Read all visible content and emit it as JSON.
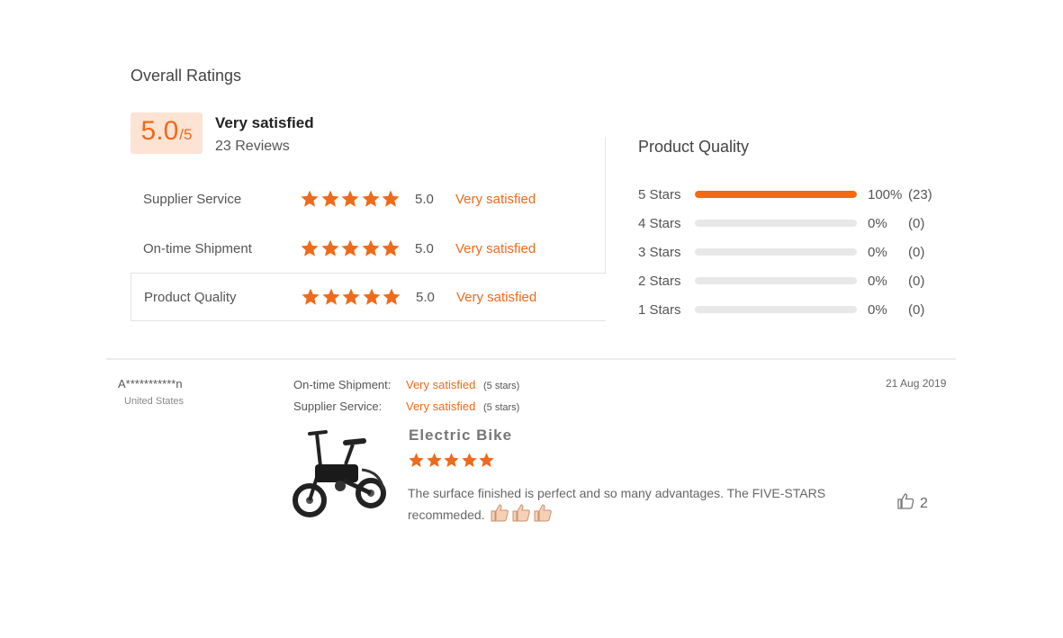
{
  "overall": {
    "title": "Overall Ratings",
    "score": "5.0",
    "out_of": "/5",
    "summary": "Very satisfied",
    "reviews": "23 Reviews"
  },
  "ratings": [
    {
      "label": "Supplier Service",
      "stars": 5,
      "score": "5.0",
      "text": "Very satisfied"
    },
    {
      "label": "On-time Shipment",
      "stars": 5,
      "score": "5.0",
      "text": "Very satisfied"
    },
    {
      "label": "Product Quality",
      "stars": 5,
      "score": "5.0",
      "text": "Very satisfied"
    }
  ],
  "product_quality": {
    "title": "Product Quality",
    "rows": [
      {
        "label": "5 Stars",
        "percent": "100%",
        "count": "(23)",
        "fraction": 1.0
      },
      {
        "label": "4 Stars",
        "percent": "0%",
        "count": "(0)",
        "fraction": 0
      },
      {
        "label": "3 Stars",
        "percent": "0%",
        "count": "(0)",
        "fraction": 0
      },
      {
        "label": "2 Stars",
        "percent": "0%",
        "count": "(0)",
        "fraction": 0
      },
      {
        "label": "1 Stars",
        "percent": "0%",
        "count": "(0)",
        "fraction": 0
      }
    ]
  },
  "review": {
    "name": "A***********n",
    "country": "United States",
    "date": "21 Aug 2019",
    "meta": [
      {
        "label": "On-time Shipment:",
        "value": "Very satisfied",
        "stars": "(5 stars)"
      },
      {
        "label": "Supplier Service:",
        "value": "Very satisfied",
        "stars": "(5 stars)"
      }
    ],
    "product": "Electric Bike",
    "rating": 5,
    "text": "The surface finished is perfect and so many advantages. The FIVE-STARS recommeded.",
    "likes": "2"
  },
  "colors": {
    "accent": "#ef6a1a",
    "score_bg": "#fde3d4",
    "bar_fill": "#f26a14",
    "bar_track": "#e8e8e8"
  },
  "icons": [
    "star-icon",
    "thumbs-up-icon",
    "thumb-emoji-icon",
    "bike-image"
  ]
}
